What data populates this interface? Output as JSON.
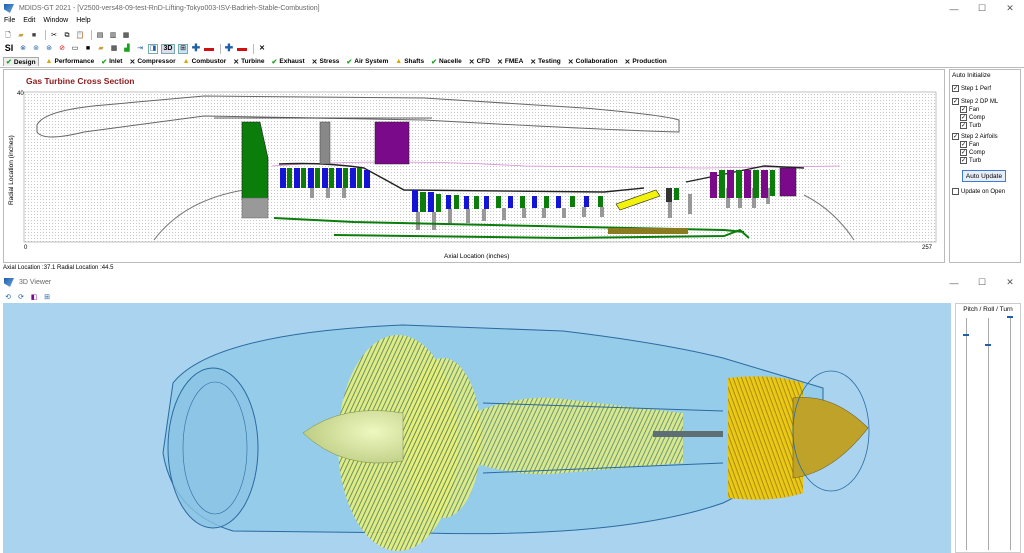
{
  "main_window": {
    "title": "MDIDS-GT 2021 - [V2500-vers48-09-test-RnD-Lifting-Tokyo003-ISV-Badrieh-Stable-Combustion]",
    "controls": {
      "minimize": "—",
      "maximize": "☐",
      "close": "✕"
    },
    "menu": [
      "File",
      "Edit",
      "Window",
      "Help"
    ],
    "toolbar": {
      "units": "SI",
      "view3d": "3D"
    },
    "tabs": [
      {
        "label": "Design",
        "status": "ok"
      },
      {
        "label": "Performance",
        "status": "warn"
      },
      {
        "label": "Inlet",
        "status": "ok"
      },
      {
        "label": "Compressor",
        "status": "x"
      },
      {
        "label": "Combustor",
        "status": "warn"
      },
      {
        "label": "Turbine",
        "status": "x"
      },
      {
        "label": "Exhaust",
        "status": "ok"
      },
      {
        "label": "Stress",
        "status": "x"
      },
      {
        "label": "Air System",
        "status": "ok"
      },
      {
        "label": "Shafts",
        "status": "warn"
      },
      {
        "label": "Nacelle",
        "status": "ok"
      },
      {
        "label": "CFD",
        "status": "x"
      },
      {
        "label": "FMEA",
        "status": "x"
      },
      {
        "label": "Testing",
        "status": "x"
      },
      {
        "label": "Collaboration",
        "status": "x"
      },
      {
        "label": "Production",
        "status": "x"
      }
    ],
    "plot": {
      "title": "Gas Turbine Cross Section",
      "xlabel": "Axial Location (inches)",
      "ylabel": "Radial Location (inches)",
      "x_min": "0",
      "x_max": "257",
      "y_max": "40"
    },
    "side_panel": {
      "header": "Auto Initialize",
      "step1": "Step 1 Perf",
      "step2": "Step 2 DP ML",
      "step2_items": [
        "Fan",
        "Comp",
        "Turb"
      ],
      "step3": "Step 2 Airfoils",
      "step3_items": [
        "Fan",
        "Comp",
        "Turb"
      ],
      "auto_update": "Auto Update",
      "update_on_open": "Update on Open"
    },
    "status": "Axial Location :37.1  Radial Location :44.5"
  },
  "viewer_window": {
    "title": "3D Viewer",
    "panel_header": "Pitch / Roll / Turn"
  },
  "colors": {
    "tab_ok": "#19a319",
    "tab_warn": "#d8a800",
    "plot_title": "#8b1a1a",
    "fan_green": "#0b7d0b",
    "purple": "#7a0a8a",
    "blue_blade": "#1414d4",
    "viewer_bg": "#a9d3ee",
    "blade_yellow": "#e6f07a",
    "turbine_gold": "#f5d820"
  }
}
